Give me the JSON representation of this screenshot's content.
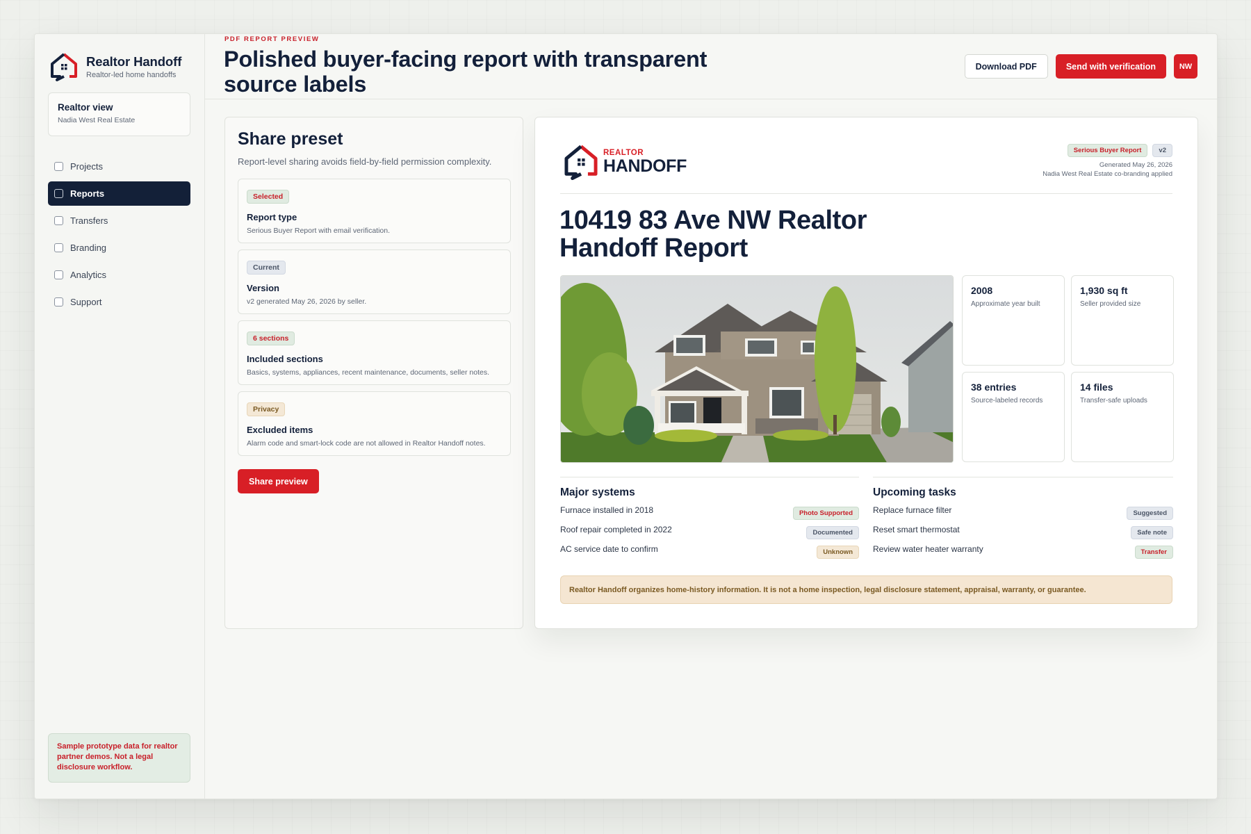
{
  "sidebar": {
    "brand_title": "Realtor Handoff",
    "brand_sub": "Realtor-led home handoffs",
    "realtor_card": {
      "title": "Realtor view",
      "subtitle": "Nadia West Real Estate"
    },
    "nav": [
      {
        "label": "Projects",
        "active": false
      },
      {
        "label": "Reports",
        "active": true
      },
      {
        "label": "Transfers",
        "active": false
      },
      {
        "label": "Branding",
        "active": false
      },
      {
        "label": "Analytics",
        "active": false
      },
      {
        "label": "Support",
        "active": false
      }
    ],
    "sample_note": "Sample prototype data for realtor partner demos. Not a legal disclosure workflow."
  },
  "header": {
    "eyebrow": "PDF REPORT PREVIEW",
    "title": "Polished buyer-facing report with transparent source labels",
    "download_label": "Download PDF",
    "send_label": "Send with verification",
    "avatar_initials": "NW"
  },
  "share": {
    "title": "Share preset",
    "subtitle": "Report-level sharing avoids field-by-field permission complexity.",
    "cards": [
      {
        "badge": "Selected",
        "title": "Report type",
        "desc": "Serious Buyer Report with email verification."
      },
      {
        "badge": "Current",
        "title": "Version",
        "desc": "v2 generated May 26, 2026 by seller."
      },
      {
        "badge": "6 sections",
        "title": "Included sections",
        "desc": "Basics, systems, appliances, recent maintenance, documents, seller notes."
      },
      {
        "badge": "Privacy",
        "title": "Excluded items",
        "desc": "Alarm code and smart-lock code are not allowed in Realtor Handoff notes."
      }
    ],
    "button_label": "Share preview"
  },
  "report": {
    "logo_small": "REALTOR",
    "logo_big": "HANDOFF",
    "badge_type": "Serious Buyer Report",
    "badge_version": "v2",
    "generated": "Generated May 26, 2026",
    "cobranding": "Nadia West Real Estate co-branding applied",
    "title": "10419 83 Ave NW Realtor Handoff Report",
    "stats": [
      {
        "value": "2008",
        "label": "Approximate year built"
      },
      {
        "value": "1,930 sq ft",
        "label": "Seller provided size"
      },
      {
        "value": "38 entries",
        "label": "Source-labeled records"
      },
      {
        "value": "14 files",
        "label": "Transfer-safe uploads"
      }
    ],
    "major_systems": {
      "title": "Major systems",
      "rows": [
        {
          "text": "Furnace installed in 2018",
          "badge": "Photo Supported"
        },
        {
          "text": "Roof repair completed in 2022",
          "badge": "Documented"
        },
        {
          "text": "AC service date to confirm",
          "badge": "Unknown"
        }
      ]
    },
    "upcoming_tasks": {
      "title": "Upcoming tasks",
      "rows": [
        {
          "text": "Replace furnace filter",
          "badge": "Suggested"
        },
        {
          "text": "Reset smart thermostat",
          "badge": "Safe note"
        },
        {
          "text": "Review water heater warranty",
          "badge": "Transfer"
        }
      ]
    },
    "disclaimer": "Realtor Handoff organizes home-history information. It is not a home inspection, legal disclosure statement, appraisal, warranty, or guarantee."
  },
  "colors": {
    "brand_red": "#d81f26",
    "navy": "#13203a",
    "badge_green": "#e0ebe1",
    "badge_slate": "#e4e8ee",
    "badge_amber": "#f4e8d6"
  }
}
